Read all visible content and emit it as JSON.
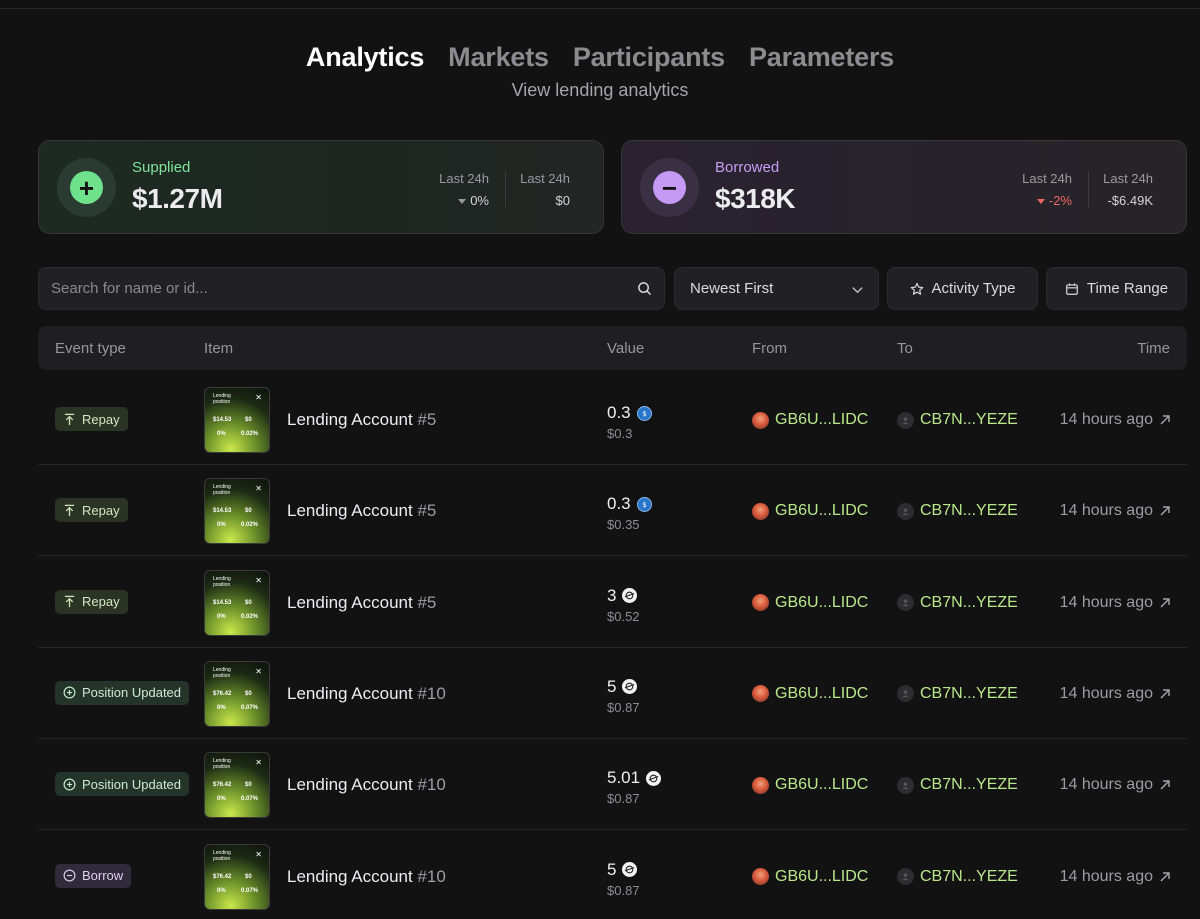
{
  "nav": {
    "tabs": [
      {
        "label": "Analytics",
        "active": true
      },
      {
        "label": "Markets",
        "active": false
      },
      {
        "label": "Participants",
        "active": false
      },
      {
        "label": "Parameters",
        "active": false
      }
    ],
    "subtitle": "View lending analytics"
  },
  "stats": {
    "supplied": {
      "label": "Supplied",
      "amount": "$1.27M",
      "change_label": "Last 24h",
      "change_pct": "0%",
      "change_value_label": "Last 24h",
      "change_value": "$0"
    },
    "borrowed": {
      "label": "Borrowed",
      "amount": "$318K",
      "change_label": "Last 24h",
      "change_pct": "-2%",
      "change_value_label": "Last 24h",
      "change_value": "-$6.49K"
    }
  },
  "filters": {
    "search_placeholder": "Search for name or id...",
    "sort_label": "Newest First",
    "activity_label": "Activity Type",
    "time_label": "Time Range"
  },
  "table": {
    "headers": {
      "event": "Event type",
      "item": "Item",
      "value": "Value",
      "from": "From",
      "to": "To",
      "time": "Time"
    },
    "thumb": {
      "title_line1": "Lending",
      "title_line2": "position",
      "val1": "$14.53",
      "val2": "$0",
      "val3": "0%",
      "val4": "0.02%"
    },
    "thumb_alt": {
      "val1": "$76.42",
      "val2": "$0",
      "val3": "0%",
      "val4": "0.07%"
    },
    "rows": [
      {
        "event": "Repay",
        "item": "Lending Account",
        "num": "#5",
        "value": "0.3",
        "usd": "$0.3",
        "from": "GB6U...LIDC",
        "to": "CB7N...YEZE",
        "time": "14 hours ago"
      },
      {
        "event": "Repay",
        "item": "Lending Account",
        "num": "#5",
        "value": "0.3",
        "usd": "$0.35",
        "from": "GB6U...LIDC",
        "to": "CB7N...YEZE",
        "time": "14 hours ago"
      },
      {
        "event": "Repay",
        "item": "Lending Account",
        "num": "#5",
        "value": "3",
        "usd": "$0.52",
        "from": "GB6U...LIDC",
        "to": "CB7N...YEZE",
        "time": "14 hours ago"
      },
      {
        "event": "Position Updated",
        "item": "Lending Account",
        "num": "#10",
        "value": "5",
        "usd": "$0.87",
        "from": "GB6U...LIDC",
        "to": "CB7N...YEZE",
        "time": "14 hours ago"
      },
      {
        "event": "Position Updated",
        "item": "Lending Account",
        "num": "#10",
        "value": "5.01",
        "usd": "$0.87",
        "from": "GB6U...LIDC",
        "to": "CB7N...YEZE",
        "time": "14 hours ago"
      },
      {
        "event": "Borrow",
        "item": "Lending Account",
        "num": "#10",
        "value": "5",
        "usd": "$0.87",
        "from": "GB6U...LIDC",
        "to": "CB7N...YEZE",
        "time": "14 hours ago"
      }
    ]
  }
}
